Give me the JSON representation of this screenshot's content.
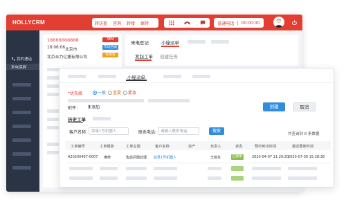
{
  "app": {
    "logo": "HOLLYCRM"
  },
  "toolbar": {
    "call_actions": [
      "转访查",
      "咨询",
      "转接",
      "保持"
    ],
    "status_label": "普通电话",
    "timer": "00:00:30"
  },
  "sidebar": {
    "section_label": "我的通话",
    "items": [
      {
        "label": "来电保屏"
      }
    ]
  },
  "call_info": {
    "phone": "18666668888",
    "time": "16:06:06",
    "city": "北京市",
    "company": "北京合力亿捷有限公司",
    "tags": [
      {
        "label": "SEM",
        "color": "#e23e31"
      },
      {
        "label": "市场咨询",
        "color": "#3b8fe0"
      },
      {
        "label": "优质客",
        "color": "#f2a024"
      }
    ]
  },
  "work_area": {
    "top_tabs": [
      "来电登记",
      "小秘派单"
    ],
    "sub_tabs": [
      "发起工单",
      "创建任务"
    ]
  },
  "dialog": {
    "title": "小秘派单",
    "priority_label": "*优先级",
    "priority_options": [
      "一般",
      "重要",
      "紧急"
    ],
    "priority_selected": "一般",
    "create_button": "创建",
    "cancel_button": "取消",
    "attachment_label": "附件：",
    "attachment_add": "添加",
    "history_title": "历史工单",
    "customer_label": "客户名称:",
    "customer_placeholder": "如录1号机器人",
    "phone_label": "联系电话:",
    "phone_placeholder": "请输入联系电话",
    "search_button": "搜索",
    "result_count": "共查询到 8 条数据",
    "table": {
      "columns": [
        "工单编号",
        "工单模板",
        "工单主题",
        "客户名称",
        "资产",
        "负责人",
        "状态",
        "预约到访时间",
        "最近更新时间"
      ],
      "rows": [
        [
          "A20200407-0007",
          "维修",
          "售后问题处理",
          "如录1号机器人",
          "",
          "王晓永",
          "已接单",
          "2020-04-07 11:29:20",
          "2020-07-30 15:28:38"
        ]
      ]
    }
  }
}
